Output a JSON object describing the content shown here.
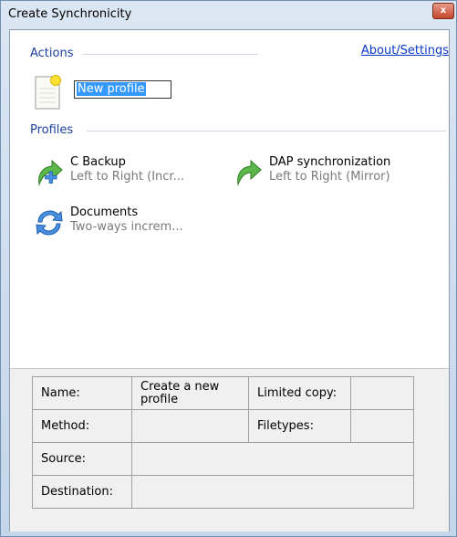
{
  "window": {
    "title": "Create Synchronicity",
    "close_symbol": "x"
  },
  "actions": {
    "group_label": "Actions",
    "about_link": "About/Settings",
    "new_profile_value": "New profile"
  },
  "profiles": {
    "group_label": "Profiles",
    "items": [
      {
        "name": "C Backup",
        "description": "Left to Right (Incr...",
        "icon": "arrow-add-icon"
      },
      {
        "name": "DAP synchronization",
        "description": "Left to Right (Mirror)",
        "icon": "arrow-icon"
      },
      {
        "name": "Documents",
        "description": "Two-ways increm...",
        "icon": "two-way-sync-icon"
      }
    ]
  },
  "info_panel": {
    "name_label": "Name:",
    "name_value": "Create a new profile",
    "limited_copy_label": "Limited copy:",
    "limited_copy_value": "",
    "method_label": "Method:",
    "method_value": "",
    "filetypes_label": "Filetypes:",
    "filetypes_value": "",
    "source_label": "Source:",
    "source_value": "",
    "destination_label": "Destination:",
    "destination_value": ""
  },
  "colors": {
    "group_label": "#1a3f9f",
    "link": "#0a38c8",
    "icon_green": "#4aa03a",
    "icon_blue": "#3a7bd0"
  }
}
